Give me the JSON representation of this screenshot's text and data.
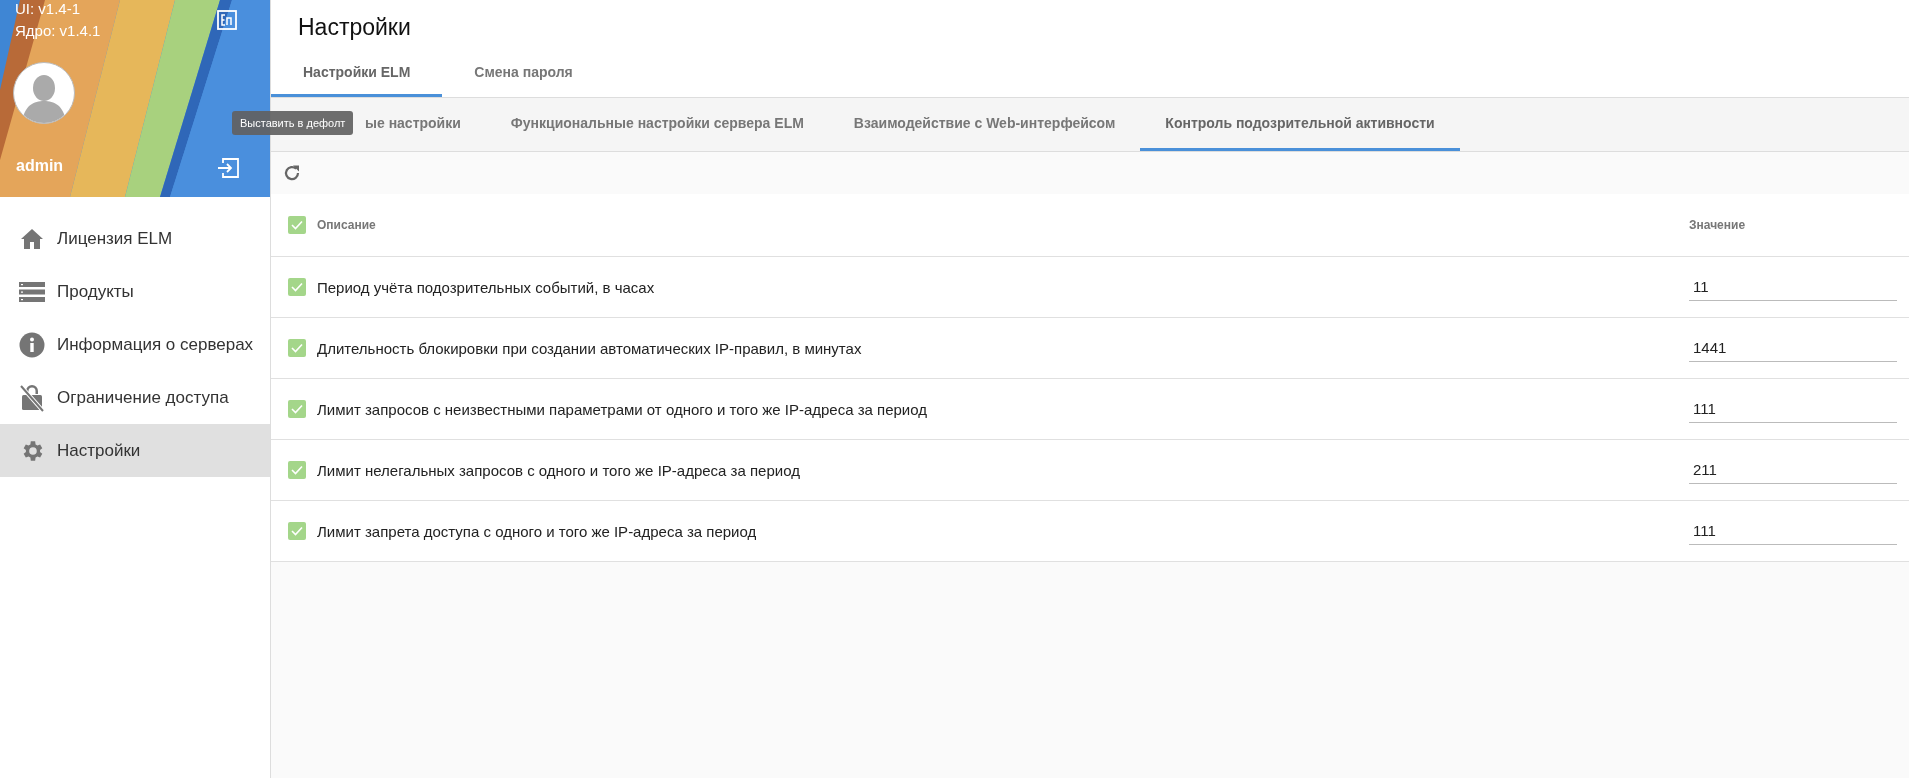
{
  "sidebar": {
    "ui_version": "UI: v1.4-1",
    "core_version": "Ядро: v1.4.1",
    "user": "admin",
    "menu": [
      {
        "label": "Лицензия ELM",
        "selected": false
      },
      {
        "label": "Продукты",
        "selected": false
      },
      {
        "label": "Информация о серверах",
        "selected": false
      },
      {
        "label": "Ограничение доступа",
        "selected": false
      },
      {
        "label": "Настройки",
        "selected": true
      }
    ]
  },
  "tooltip": "Выставить в дефолт",
  "page": {
    "title": "Настройки",
    "tabs": [
      {
        "label": "Настройки ELM",
        "selected": true
      },
      {
        "label": "Смена пароля",
        "selected": false
      }
    ],
    "subtabs": [
      {
        "label": "ые настройки",
        "selected": false
      },
      {
        "label": "Функциональные настройки сервера ELM",
        "selected": false
      },
      {
        "label": "Взаимодействие с Web-интерфейсом",
        "selected": false
      },
      {
        "label": "Контроль подозрительной активности",
        "selected": true
      }
    ]
  },
  "table": {
    "columns": [
      "Описание",
      "Значение"
    ],
    "header_checked": true,
    "rows": [
      {
        "checked": true,
        "description": "Период учёта подозрительных событий, в часах",
        "value": "11"
      },
      {
        "checked": true,
        "description": "Длительность блокировки при создании автоматических IP-правил, в минутах",
        "value": "1441"
      },
      {
        "checked": true,
        "description": "Лимит запросов с неизвестными параметрами от одного и того же IP-адреса за период",
        "value": "111"
      },
      {
        "checked": true,
        "description": "Лимит нелегальных запросов с одного и того же IP-адреса за период",
        "value": "211"
      },
      {
        "checked": true,
        "description": "Лимит запрета доступа с одного и того же IP-адреса за период",
        "value": "111"
      }
    ]
  }
}
